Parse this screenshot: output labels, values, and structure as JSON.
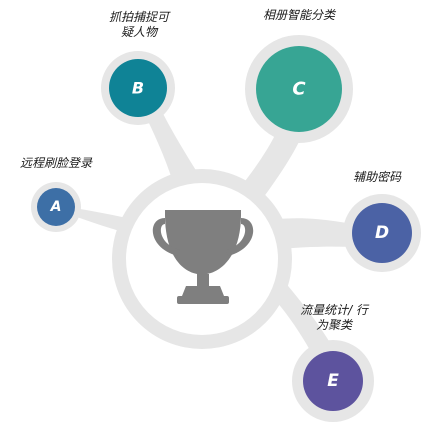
{
  "colors": {
    "track": "#e6e6e6",
    "trophy": "#7f7f7f",
    "a": "#3d6fa6",
    "b": "#0f8396",
    "c": "#37a594",
    "d": "#4b62a5",
    "e": "#5d539e"
  },
  "center": {
    "icon": "trophy-icon"
  },
  "nodes": {
    "a": {
      "letter": "A",
      "label": "远程刷脸登录"
    },
    "b": {
      "letter": "B",
      "label": "抓拍捕捉可\n疑人物"
    },
    "c": {
      "letter": "C",
      "label": "相册智能分类"
    },
    "d": {
      "letter": "D",
      "label": "辅助密码"
    },
    "e": {
      "letter": "E",
      "label": "流量统计/ 行\n为聚类"
    }
  }
}
